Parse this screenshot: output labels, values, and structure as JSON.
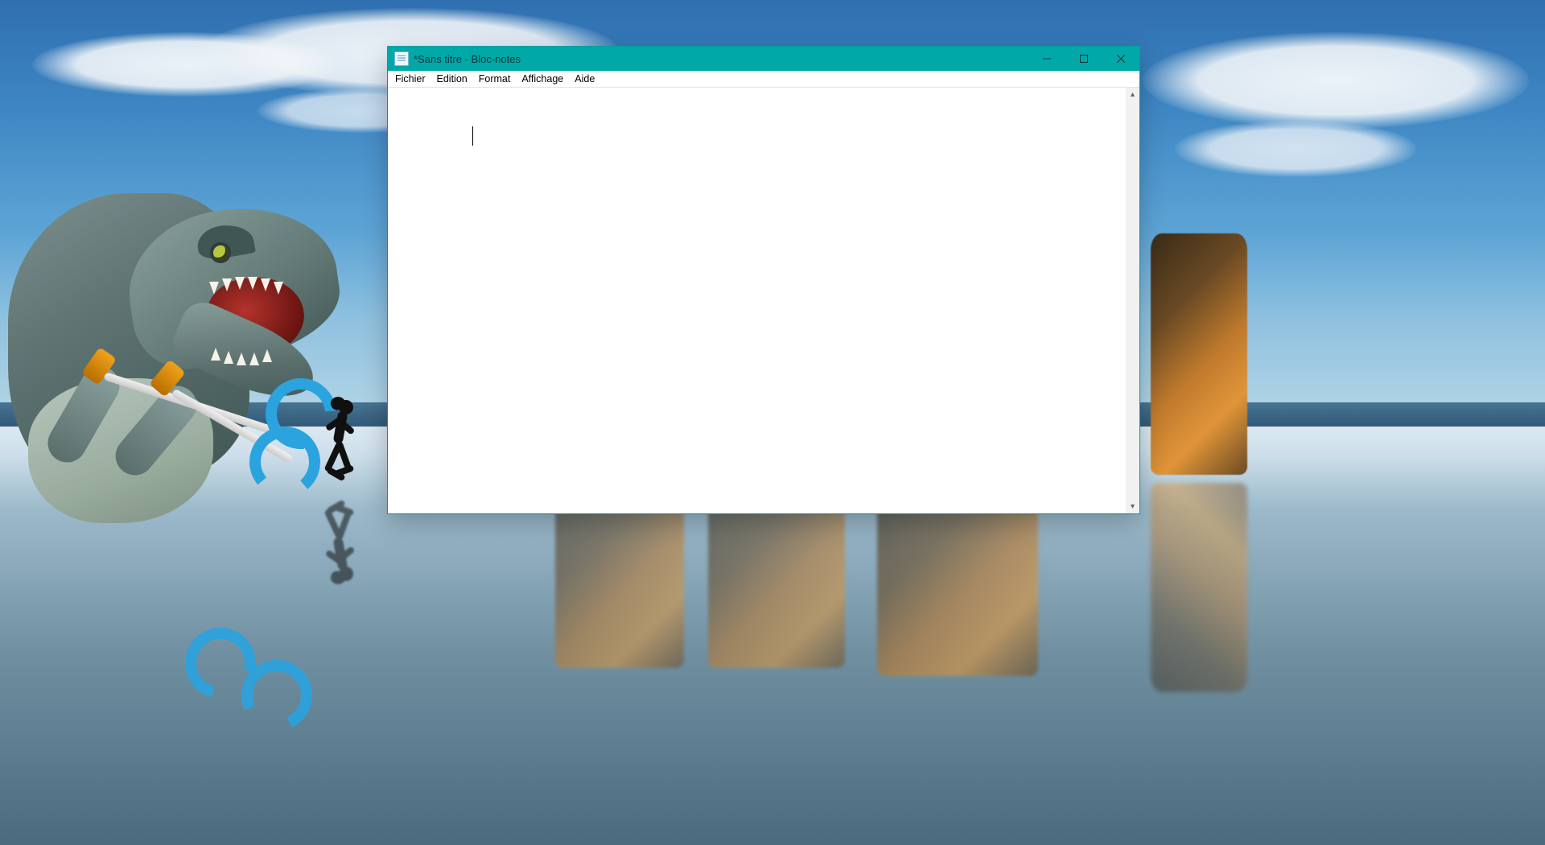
{
  "window": {
    "title": "*Sans titre - Bloc-notes"
  },
  "menu": {
    "file": "Fichier",
    "edit": "Edition",
    "format": "Format",
    "view": "Affichage",
    "help": "Aide"
  },
  "editor": {
    "content": ""
  },
  "scroll": {
    "up_glyph": "▴",
    "down_glyph": "▾"
  }
}
